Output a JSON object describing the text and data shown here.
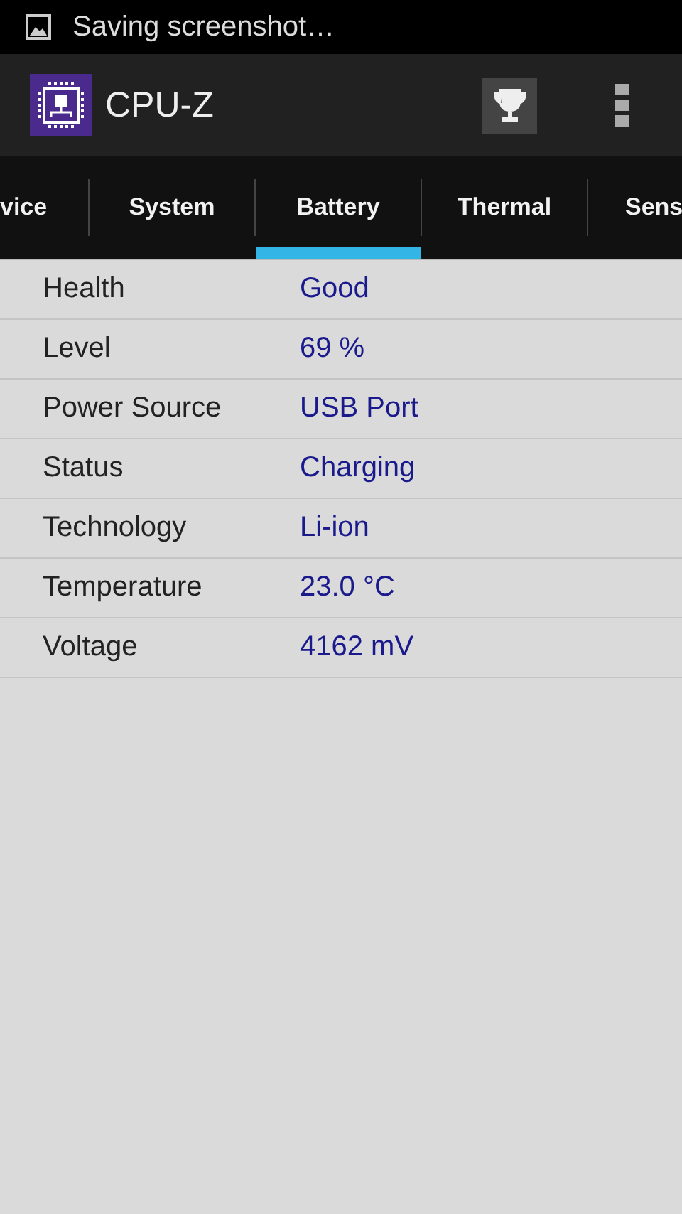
{
  "notification": {
    "text": "Saving screenshot…"
  },
  "app_bar": {
    "title": "CPU-Z"
  },
  "tabs": [
    {
      "label": "vice",
      "selected": false
    },
    {
      "label": "System",
      "selected": false
    },
    {
      "label": "Battery",
      "selected": true
    },
    {
      "label": "Thermal",
      "selected": false
    },
    {
      "label": "Sens",
      "selected": false
    }
  ],
  "rows": [
    {
      "label": "Health",
      "value": "Good"
    },
    {
      "label": "Level",
      "value": "69 %"
    },
    {
      "label": "Power Source",
      "value": "USB Port"
    },
    {
      "label": "Status",
      "value": "Charging"
    },
    {
      "label": "Technology",
      "value": "Li-ion"
    },
    {
      "label": "Temperature",
      "value": "23.0 °C"
    },
    {
      "label": "Voltage",
      "value": "4162 mV"
    }
  ]
}
